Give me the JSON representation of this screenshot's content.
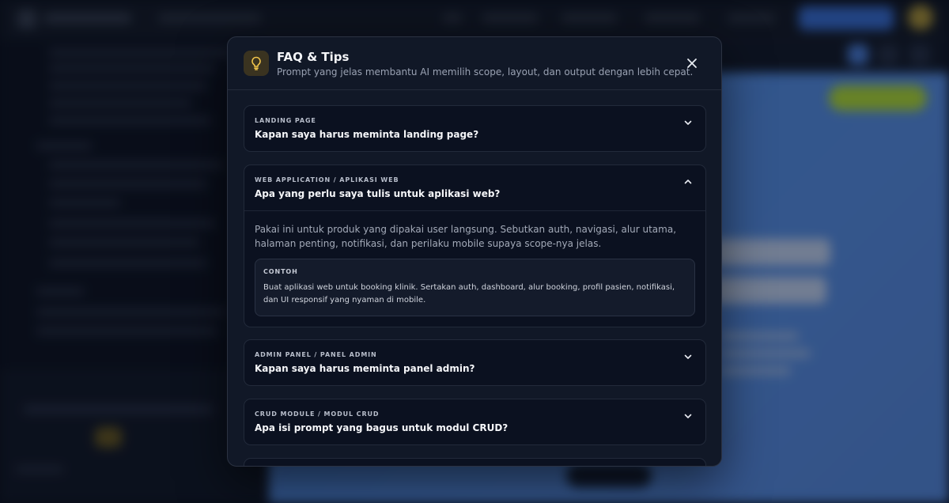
{
  "modal": {
    "title": "FAQ & Tips",
    "subtitle": "Prompt yang jelas membantu AI memilih scope, layout, dan output dengan lebih cepat.",
    "icon": "lightbulb-icon",
    "accent": "#f3c64b"
  },
  "faq": [
    {
      "category": "LANDING PAGE",
      "question": "Kapan saya harus meminta landing page?",
      "expanded": false
    },
    {
      "category": "WEB APPLICATION / APLIKASI WEB",
      "question": "Apa yang perlu saya tulis untuk aplikasi web?",
      "expanded": true,
      "answer": "Pakai ini untuk produk yang dipakai user langsung. Sebutkan auth, navigasi, alur utama, halaman penting, notifikasi, dan perilaku mobile supaya scope-nya jelas.",
      "example_label": "CONTOH",
      "example_text": "Buat aplikasi web untuk booking klinik. Sertakan auth, dashboard, alur booking, profil pasien, notifikasi, dan UI responsif yang nyaman di mobile."
    },
    {
      "category": "ADMIN PANEL / PANEL ADMIN",
      "question": "Kapan saya harus meminta panel admin?",
      "expanded": false
    },
    {
      "category": "CRUD MODULE / MODUL CRUD",
      "question": "Apa isi prompt yang bagus untuk modul CRUD?",
      "expanded": false
    }
  ]
}
